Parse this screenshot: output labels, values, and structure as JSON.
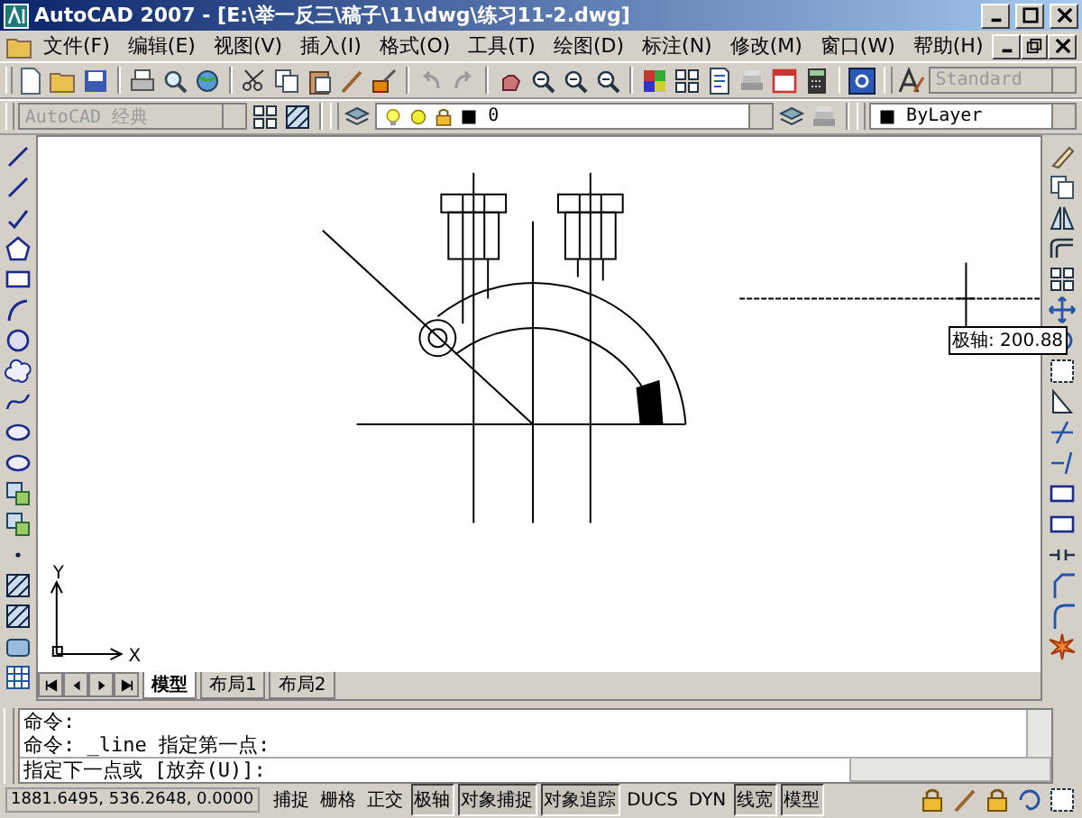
{
  "window": {
    "title": "AutoCAD 2007 - [E:\\举一反三\\稿子\\11\\dwg\\练习11-2.dwg]"
  },
  "menu": [
    "文件(F)",
    "编辑(E)",
    "视图(V)",
    "插入(I)",
    "格式(O)",
    "工具(T)",
    "绘图(D)",
    "标注(N)",
    "修改(M)",
    "窗口(W)",
    "帮助(H)"
  ],
  "text_style_combo": {
    "value": "Standard"
  },
  "workspace_combo": {
    "value": "AutoCAD 经典"
  },
  "layer_combo": {
    "value": "0"
  },
  "color_combo": {
    "value": "ByLayer"
  },
  "canvas": {
    "polar_tooltip": "极轴: 200.88",
    "ucs_x_label": "X",
    "ucs_y_label": "Y"
  },
  "layout_tabs": [
    {
      "label": "模型",
      "selected": true
    },
    {
      "label": "布局1",
      "selected": false
    },
    {
      "label": "布局2",
      "selected": false
    }
  ],
  "command_lines": [
    "命令:",
    "命令: _line 指定第一点:"
  ],
  "command_prompt": "指定下一点或 [放弃(U)]:",
  "status_bar": {
    "coordinates": "1881.6495, 536.2648, 0.0000",
    "toggles": [
      {
        "label": "捕捉",
        "on": false
      },
      {
        "label": "栅格",
        "on": false
      },
      {
        "label": "正交",
        "on": false
      },
      {
        "label": "极轴",
        "on": true
      },
      {
        "label": "对象捕捉",
        "on": true
      },
      {
        "label": "对象追踪",
        "on": true
      },
      {
        "label": "DUCS",
        "on": false
      },
      {
        "label": "DYN",
        "on": false
      },
      {
        "label": "线宽",
        "on": true
      },
      {
        "label": "模型",
        "on": true
      }
    ]
  }
}
